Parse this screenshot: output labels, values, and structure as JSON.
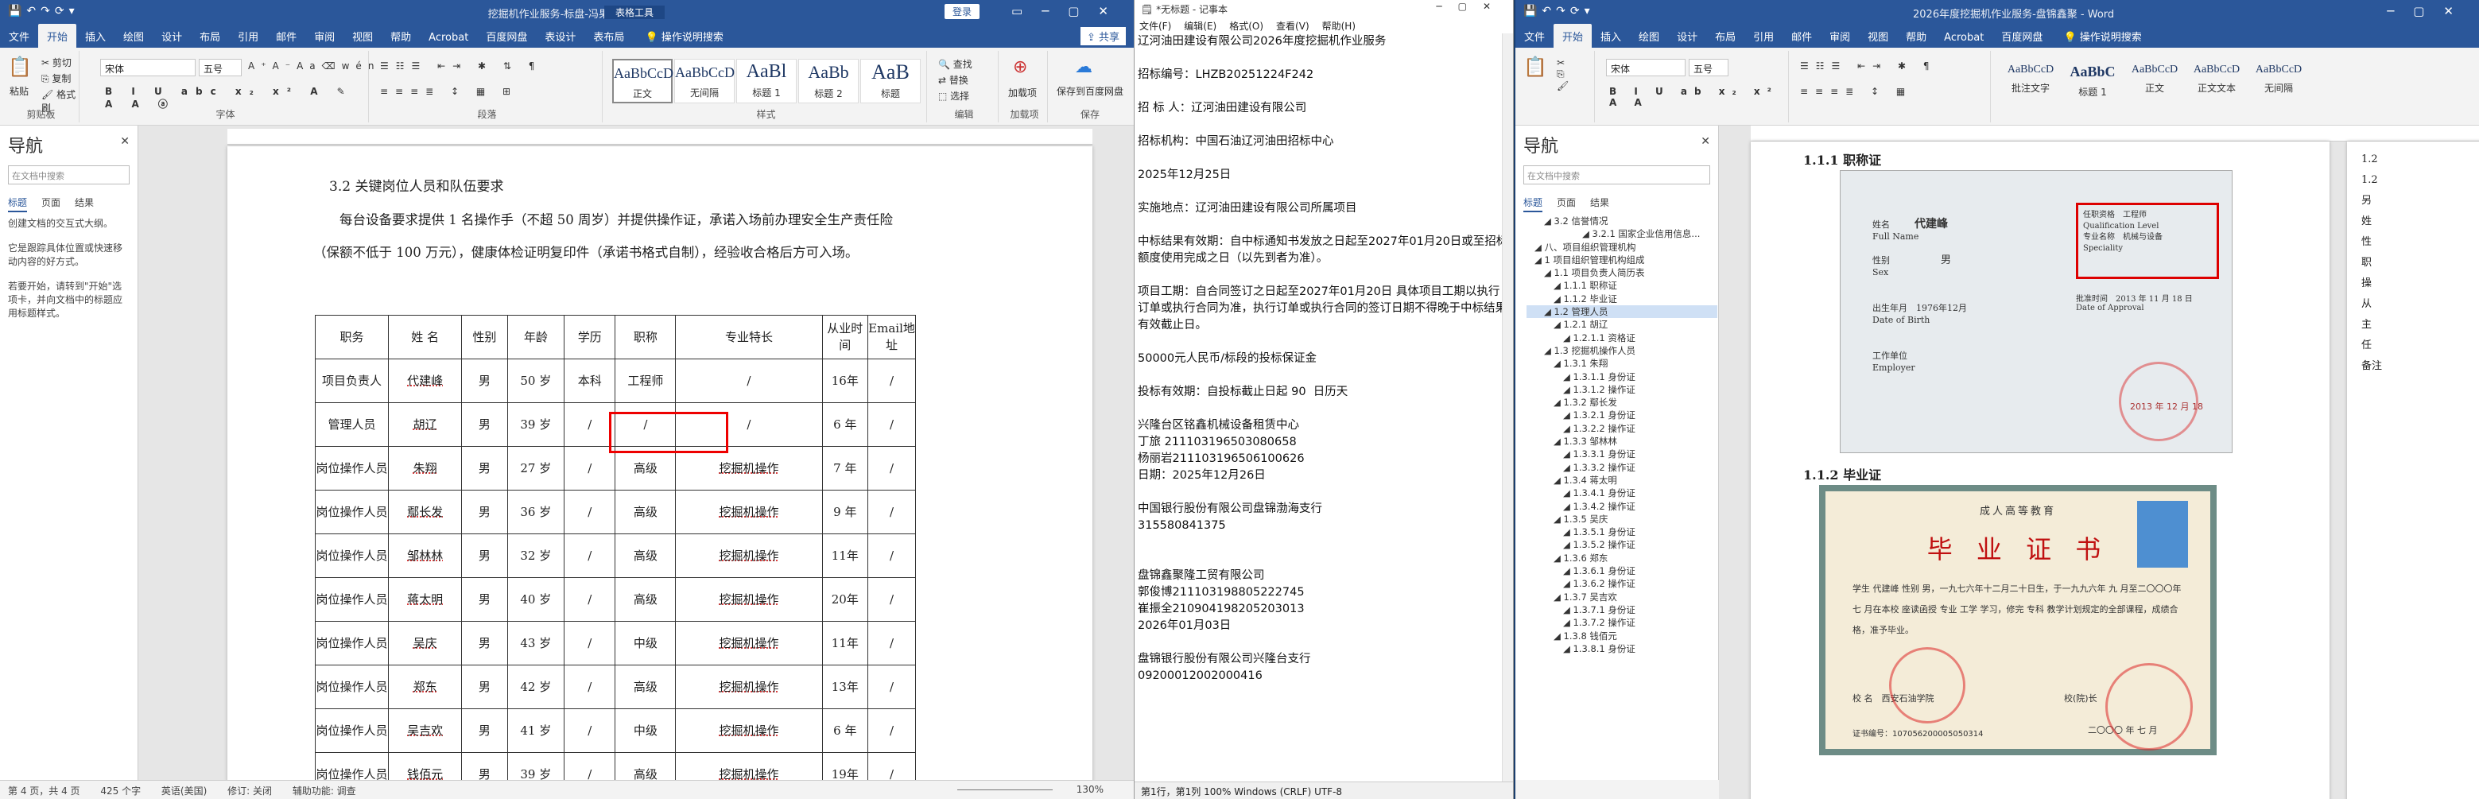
{
  "word1": {
    "title": "挖掘机作业服务-标盘-冯果 - Word",
    "context_tab": "表格工具",
    "signin": "登录",
    "tabs": [
      "文件",
      "开始",
      "插入",
      "绘图",
      "设计",
      "布局",
      "引用",
      "邮件",
      "审阅",
      "视图",
      "帮助",
      "Acrobat",
      "百度网盘",
      "表设计",
      "表布局"
    ],
    "tell_me": "操作说明搜索",
    "share": "共享",
    "font_name": "宋体",
    "font_size": "五号",
    "group_labels": [
      "剪贴板",
      "字体",
      "段落",
      "样式",
      "编辑",
      "加载项",
      "保存"
    ],
    "styles": [
      {
        "preview": "AaBbCcD",
        "name": "正文"
      },
      {
        "preview": "AaBbCcD",
        "name": "无间隔"
      },
      {
        "preview": "AaBl",
        "name": "标题 1"
      },
      {
        "preview": "AaBb",
        "name": "标题 2"
      },
      {
        "preview": "AaB",
        "name": "标题"
      }
    ],
    "clipboard": {
      "paste": "粘贴",
      "cut": "剪切",
      "copy": "复制",
      "painter": "格式刷"
    },
    "editing": [
      "查找",
      "替换",
      "选择"
    ],
    "addin": "加载项",
    "save_baidu": "保存到百度网盘",
    "nav": {
      "title": "导航",
      "search_placeholder": "在文档中搜索",
      "tabs": [
        "标题",
        "页面",
        "结果"
      ],
      "hints": [
        "创建文档的交互式大纲。",
        "它是跟踪具体位置或快速移动内容的好方式。",
        "若要开始，请转到\"开始\"选项卡，并向文档中的标题应用标题样式。"
      ]
    },
    "heading": "3.2 关键岗位人员和队伍要求",
    "para": "每台设备要求提供 1 名操作手（不超 50 周岁）并提供操作证，承诺入场前办理安全生产责任险（保额不低于 100 万元），健康体检证明复印件（承诺书格式自制），经验收合格后方可入场。",
    "table": {
      "headers": [
        "职务",
        "姓 名",
        "性别",
        "年龄",
        "学历",
        "职称",
        "专业特长",
        "从业时间",
        "Email地址"
      ],
      "rows": [
        [
          "项目负责人",
          "代建峰",
          "男",
          "50 岁",
          "本科",
          "工程师",
          "/",
          "16年",
          "/"
        ],
        [
          "管理人员",
          "胡辽",
          "男",
          "39 岁",
          "/",
          "/",
          "/",
          "6 年",
          "/"
        ],
        [
          "岗位操作人员",
          "朱翔",
          "男",
          "27 岁",
          "/",
          "高级",
          "挖掘机操作",
          "7 年",
          "/"
        ],
        [
          "岗位操作人员",
          "鄢长发",
          "男",
          "36 岁",
          "/",
          "高级",
          "挖掘机操作",
          "9 年",
          "/"
        ],
        [
          "岗位操作人员",
          "邹林林",
          "男",
          "32 岁",
          "/",
          "高级",
          "挖掘机操作",
          "11年",
          "/"
        ],
        [
          "岗位操作人员",
          "蒋太明",
          "男",
          "40 岁",
          "/",
          "高级",
          "挖掘机操作",
          "20年",
          "/"
        ],
        [
          "岗位操作人员",
          "吴庆",
          "男",
          "43 岁",
          "/",
          "中级",
          "挖掘机操作",
          "11年",
          "/"
        ],
        [
          "岗位操作人员",
          "郑东",
          "男",
          "42 岁",
          "/",
          "高级",
          "挖掘机操作",
          "13年",
          "/"
        ],
        [
          "岗位操作人员",
          "吴吉欢",
          "男",
          "41 岁",
          "/",
          "中级",
          "挖掘机操作",
          "6 年",
          "/"
        ],
        [
          "岗位操作人员",
          "钱佰元",
          "男",
          "39 岁",
          "/",
          "高级",
          "挖掘机操作",
          "19年",
          "/"
        ]
      ]
    },
    "status": {
      "page": "第 4 页，共 4 页",
      "words": "425 个字",
      "lang": "英语(美国)",
      "track": "修订: 关闭",
      "access": "辅助功能: 调查",
      "zoom": "130%"
    }
  },
  "notepad": {
    "title": "*无标题 - 记事本",
    "menu": [
      "文件(F)",
      "编辑(E)",
      "格式(O)",
      "查看(V)",
      "帮助(H)"
    ],
    "lines": [
      "辽河油田建设有限公司2026年度挖掘机作业服务",
      "",
      "招标编号：LHZB20251224F242",
      "",
      "招 标 人：辽河油田建设有限公司",
      "",
      "招标机构：中国石油辽河油田招标中心",
      "",
      "2025年12月25日",
      "",
      "实施地点：辽河油田建设有限公司所属项目",
      "",
      "中标结果有效期：自中标通知书发放之日起至2027年01月20日或至招标额度使用完成之日（以先到者为准）。",
      "",
      "项目工期：自合同签订之日起至2027年01月20日 具体项目工期以执行订单或执行合同为准，执行订单或执行合同的签订日期不得晚于中标结果有效截止日。",
      "",
      "50000元人民币/标段的投标保证金",
      "",
      "投标有效期：自投标截止日起 90  日历天",
      "",
      "兴隆台区铭鑫机械设备租赁中心",
      "丁旅 211103196503080658",
      "杨丽岩211103196506100626",
      "日期：2025年12月26日",
      "",
      "中国银行股份有限公司盘锦渤海支行",
      "315580841375",
      "",
      "",
      "盘锦鑫聚隆工贸有限公司",
      "郭俊博211103198805222745",
      "崔振全210904198205203013",
      "2026年01月03日",
      "",
      "盘锦银行股份有限公司兴隆台支行",
      "09200012002000416"
    ],
    "status": "第1行，第1列  100%  Windows (CRLF)  UTF-8"
  },
  "word2": {
    "title": "2026年度挖掘机作业服务-盘锦鑫聚 - Word",
    "tabs": [
      "文件",
      "开始",
      "插入",
      "绘图",
      "设计",
      "布局",
      "引用",
      "邮件",
      "审阅",
      "视图",
      "帮助",
      "Acrobat",
      "百度网盘"
    ],
    "tell_me": "操作说明搜索",
    "font_name": "宋体",
    "font_size": "五号",
    "styles": [
      {
        "preview": "AaBbCcD",
        "name": "批注文字"
      },
      {
        "preview": "AaBbC",
        "name": "标题 1"
      },
      {
        "preview": "AaBbCcD",
        "name": "正文"
      },
      {
        "preview": "AaBbCcD",
        "name": "正文文本"
      },
      {
        "preview": "AaBbCcD",
        "name": "无间隔"
      }
    ],
    "nav": {
      "title": "导航",
      "search_placeholder": "在文档中搜索",
      "tabs": [
        "标题",
        "页面",
        "结果"
      ]
    },
    "tree": [
      "3.2 信誉情况",
      "3.2.1 国家企业信用信息...",
      "八、项目组织管理机构",
      "1 项目组织管理机构组成",
      "1.1 项目负责人简历表",
      "1.1.1 职称证",
      "1.1.2 毕业证",
      "1.2 管理人员",
      "1.2.1 胡辽",
      "1.2.1.1 资格证",
      "1.3 挖掘机操作人员",
      "1.3.1 朱翔",
      "1.3.1.1 身份证",
      "1.3.1.2 操作证",
      "1.3.2 鄢长发",
      "1.3.2.1 身份证",
      "1.3.2.2 操作证",
      "1.3.3 邹林林",
      "1.3.3.1 身份证",
      "1.3.3.2 操作证",
      "1.3.4 蒋太明",
      "1.3.4.1 身份证",
      "1.3.4.2 操作证",
      "1.3.5 吴庆",
      "1.3.5.1 身份证",
      "1.3.5.2 操作证",
      "1.3.6 郑东",
      "1.3.6.1 身份证",
      "1.3.6.2 操作证",
      "1.3.7 吴吉欢",
      "1.3.7.1 身份证",
      "1.3.7.2 操作证",
      "1.3.8 钱佰元",
      "1.3.8.1 身份证"
    ],
    "h1": "1.1.1 职称证",
    "h2": "1.1.2 毕业证",
    "cert1": {
      "name_label": "姓名",
      "name": "代建峰",
      "full_name": "Full Name",
      "sex_label": "性别",
      "sex": "男",
      "sex_en": "Sex",
      "birth_label": "出生年月",
      "birth": "1976年12月",
      "birth_en": "Date of Birth",
      "work_label": "工作单位",
      "work_en": "Employer",
      "level_label": "任职资格",
      "level": "工程师",
      "level_en": "Qualification Level",
      "spec_label": "专业名称",
      "spec": "机械与设备",
      "spec_en": "Speciality",
      "approve_label": "批准时间",
      "approve": "2013 年 11 月 18 日",
      "approve_en": "Date of Approval",
      "issue_date": "2013 年 12 月 18"
    },
    "cert2": {
      "header": "成人高等教育",
      "title": "毕 业 证 书",
      "body": "学生 代建峰 性别 男，一九七六年十二月二十日生，于一九九六年 九 月至二〇〇〇年 七 月在本校 座读函授 专业 工学 学习，修完 专科 教学计划规定的全部课程，成绩合格，准予毕业。",
      "school_label": "校 名",
      "school": "西安石油学院",
      "head_label": "校(院)长",
      "cert_no": "证书编号：107056200005050314",
      "date": "二〇〇〇 年 七 月"
    },
    "right_col": [
      "1.2",
      "1.2",
      "另",
      "姓",
      "性",
      "职",
      "操",
      "从",
      "主",
      "任",
      "备注"
    ]
  },
  "colors": {
    "word_blue": "#2b579a",
    "desktop": "#1b3f6e",
    "highlight_red": "#e00000"
  }
}
